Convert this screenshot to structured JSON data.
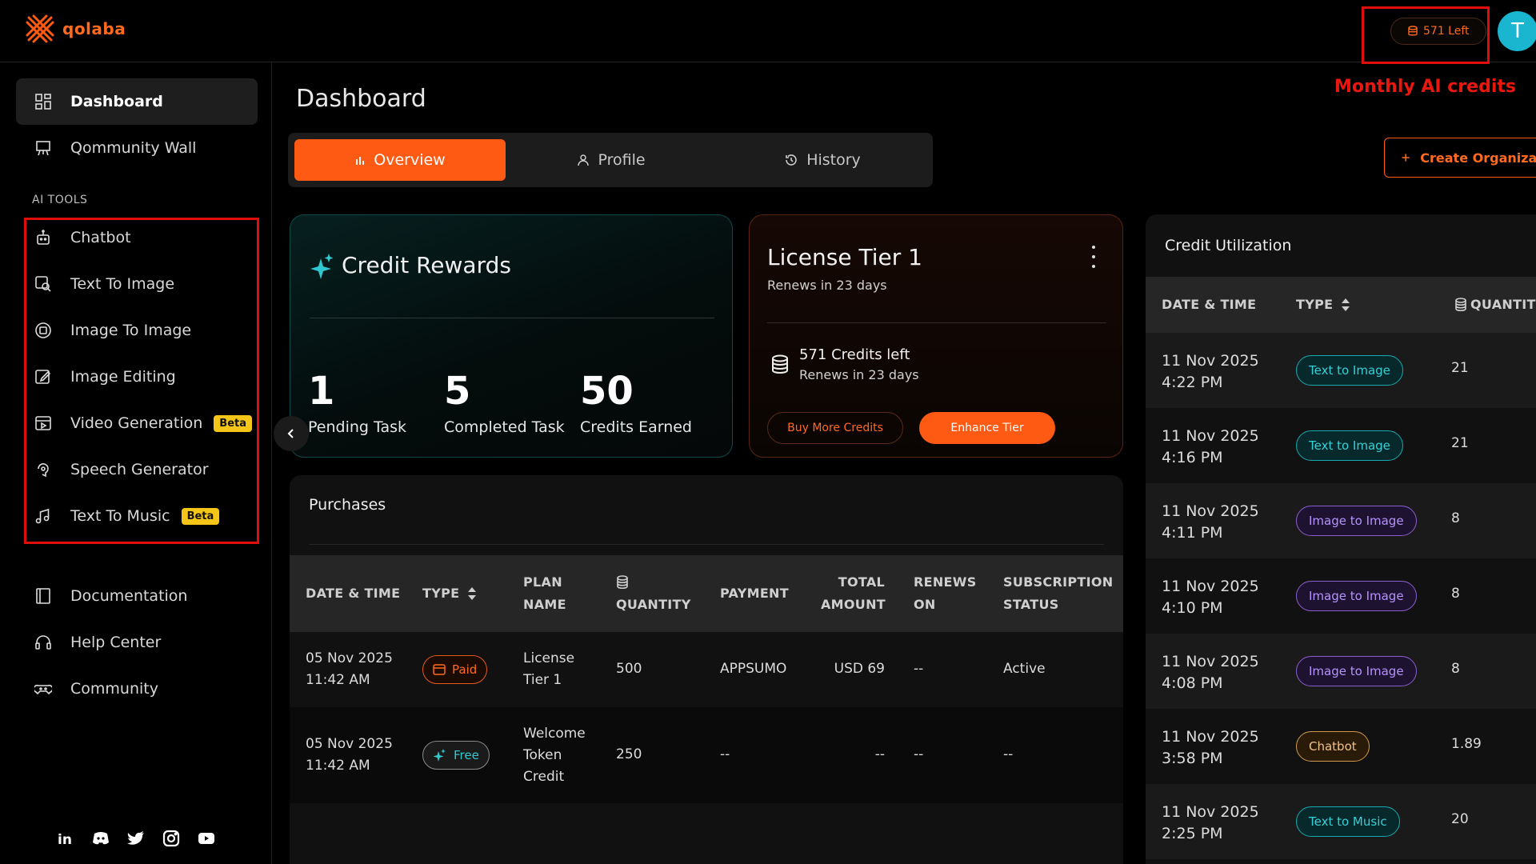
{
  "brand": {
    "name": "qolaba",
    "accent": "#ff5a14"
  },
  "header": {
    "credits_left": "571 Left",
    "avatar_initial": "T",
    "annotation": "Monthly AI credits"
  },
  "sidebar": {
    "top_items": [
      {
        "label": "Dashboard",
        "icon": "grid-icon",
        "active": true
      },
      {
        "label": "Qommunity Wall",
        "icon": "board-icon"
      }
    ],
    "section_label": "AI TOOLS",
    "tools": [
      {
        "label": "Chatbot",
        "icon": "robot-icon"
      },
      {
        "label": "Text To Image",
        "icon": "image-search-icon"
      },
      {
        "label": "Image To Image",
        "icon": "image-swap-icon"
      },
      {
        "label": "Image Editing",
        "icon": "edit-icon"
      },
      {
        "label": "Video Generation",
        "icon": "video-icon",
        "badge": "Beta"
      },
      {
        "label": "Speech Generator",
        "icon": "speech-icon"
      },
      {
        "label": "Text To Music",
        "icon": "music-icon",
        "badge": "Beta"
      }
    ],
    "bottom_items": [
      {
        "label": "Documentation",
        "icon": "book-icon"
      },
      {
        "label": "Help Center",
        "icon": "headset-icon"
      },
      {
        "label": "Community",
        "icon": "gamepad-icon"
      }
    ],
    "socials": [
      {
        "label": "in",
        "icon": "linkedin-icon"
      },
      {
        "label": "discord",
        "icon": "discord-icon"
      },
      {
        "label": "twitter",
        "icon": "twitter-icon"
      },
      {
        "label": "instagram",
        "icon": "instagram-icon"
      },
      {
        "label": "youtube",
        "icon": "youtube-icon"
      }
    ]
  },
  "main": {
    "title": "Dashboard",
    "tabs": [
      {
        "label": "Overview",
        "active": true
      },
      {
        "label": "Profile"
      },
      {
        "label": "History"
      }
    ],
    "create_button": "Create Organizat"
  },
  "rewards": {
    "title": "Credit Rewards",
    "stats": [
      {
        "value": "1",
        "label": "Pending Task"
      },
      {
        "value": "5",
        "label": "Completed Task"
      },
      {
        "value": "50",
        "label": "Credits Earned"
      }
    ]
  },
  "license": {
    "title": "License Tier 1",
    "renews": "Renews in 23 days",
    "credits": "571 Credits left",
    "credits_renews": "Renews in 23 days",
    "buy_button": "Buy More Credits",
    "enhance_button": "Enhance Tier"
  },
  "purchases": {
    "title": "Purchases",
    "headers": {
      "date": "DATE & TIME",
      "type": "TYPE",
      "plan_1": "PLAN",
      "plan_2": "NAME",
      "quantity": "QUANTITY",
      "payment": "PAYMENT",
      "total_1": "TOTAL",
      "total_2": "AMOUNT",
      "renews_1": "RENEWS",
      "renews_2": "ON",
      "status_1": "SUBSCRIPTION",
      "status_2": "STATUS"
    },
    "rows": [
      {
        "date": "05 Nov 2025",
        "time": "11:42 AM",
        "type": "Paid",
        "plan_1": "License",
        "plan_2": "Tier 1",
        "plan_3": "",
        "quantity": "500",
        "payment": "APPSUMO",
        "total": "USD 69",
        "renews": "--",
        "status": "Active"
      },
      {
        "date": "05 Nov 2025",
        "time": "11:42 AM",
        "type": "Free",
        "plan_1": "Welcome",
        "plan_2": "Token",
        "plan_3": "Credit",
        "quantity": "250",
        "payment": "--",
        "total": "--",
        "renews": "--",
        "status": "--"
      }
    ]
  },
  "utilization": {
    "title": "Credit Utilization",
    "headers": {
      "date": "DATE & TIME",
      "type": "TYPE",
      "quantity": "QUANTITY"
    },
    "rows": [
      {
        "date": "11 Nov 2025",
        "time": "4:22 PM",
        "type": "Text to Image",
        "kind": "text",
        "quantity": "21"
      },
      {
        "date": "11 Nov 2025",
        "time": "4:16 PM",
        "type": "Text to Image",
        "kind": "text",
        "quantity": "21"
      },
      {
        "date": "11 Nov 2025",
        "time": "4:11 PM",
        "type": "Image to Image",
        "kind": "image",
        "quantity": "8"
      },
      {
        "date": "11 Nov 2025",
        "time": "4:10 PM",
        "type": "Image to Image",
        "kind": "image",
        "quantity": "8"
      },
      {
        "date": "11 Nov 2025",
        "time": "4:08 PM",
        "type": "Image to Image",
        "kind": "image",
        "quantity": "8"
      },
      {
        "date": "11 Nov 2025",
        "time": "3:58 PM",
        "type": "Chatbot",
        "kind": "chat",
        "quantity": "1.89"
      },
      {
        "date": "11 Nov 2025",
        "time": "2:25 PM",
        "type": "Text to Music",
        "kind": "music",
        "quantity": "20"
      }
    ]
  }
}
